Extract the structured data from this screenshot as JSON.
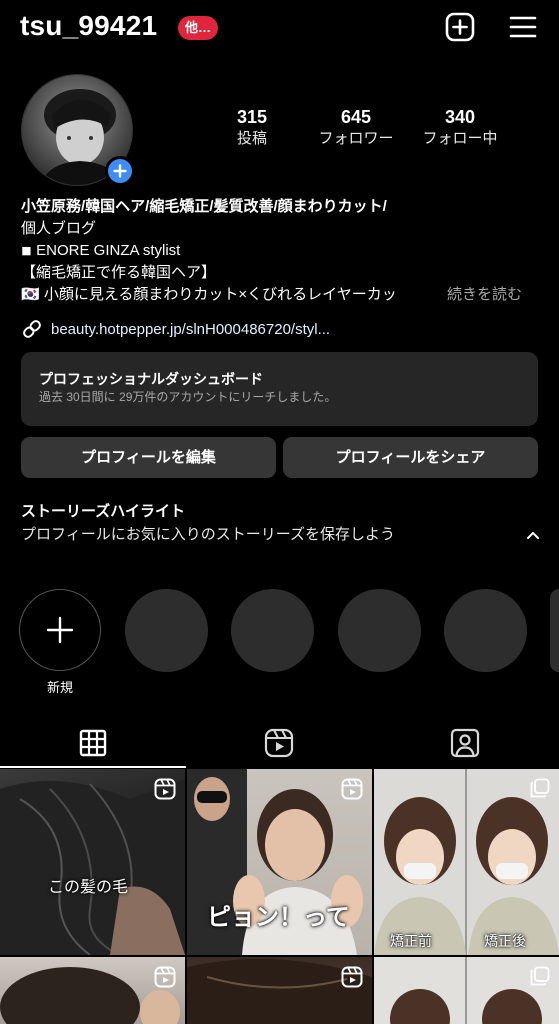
{
  "header": {
    "username": "tsu_99421",
    "notification_badge": "他…",
    "create_icon": "plus-square-icon",
    "menu_icon": "hamburger-menu-icon"
  },
  "profile": {
    "avatar_badge_icon": "plus-icon",
    "stats": [
      {
        "value": "315",
        "label": "投稿"
      },
      {
        "value": "645",
        "label": "フォロワー"
      },
      {
        "value": "340",
        "label": "フォロー中"
      }
    ],
    "bio": {
      "line1": "小笠原務/韓国ヘア/縮毛矯正/髪質改善/顔まわりカット/",
      "line2": "個人ブログ",
      "line3": "◾ ENORE GINZA stylist",
      "line4": "【縮毛矯正で作る韓国ヘア】",
      "line5": "🇰🇷 小顔に見える顔まわりカット×くびれるレイヤーカッ",
      "more": "続きを読む"
    },
    "link_icon": "link-icon",
    "link": "beauty.hotpepper.jp/slnH000486720/styl..."
  },
  "dashboard": {
    "title": "プロフェッショナルダッシュボード",
    "subtitle": "過去 30日間に 29万件のアカウントにリーチしました。"
  },
  "actions": {
    "edit": "プロフィールを編集",
    "share": "プロフィールをシェア"
  },
  "highlights": {
    "title": "ストーリーズハイライト",
    "subtitle": "プロフィールにお気に入りのストーリーズを保存しよう",
    "new_label": "新規"
  },
  "tabs": [
    "grid-icon",
    "reels-icon",
    "tagged-icon"
  ],
  "grid": {
    "captions": {
      "t1": "この髪の毛",
      "t2": "ピョン！って",
      "t3a": "矯正前",
      "t3b": "矯正後"
    }
  },
  "colors": {
    "background": "#000000",
    "accent_blue": "#3f8cf6",
    "badge_red": "#e0263d",
    "surface": "#262626",
    "button": "#363636",
    "muted_text": "#a8a8a8"
  }
}
